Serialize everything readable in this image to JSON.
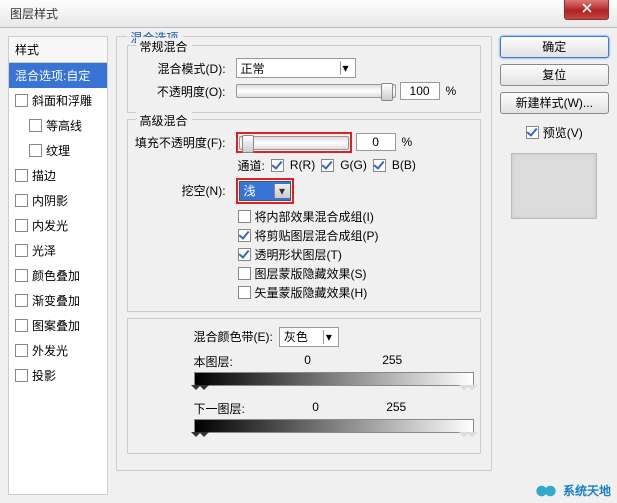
{
  "window": {
    "title": "图层样式"
  },
  "styles": {
    "header": "样式",
    "items": [
      {
        "label": "混合选项:自定",
        "selected": true,
        "noCheckbox": true
      },
      {
        "label": "斜面和浮雕"
      },
      {
        "label": "等高线",
        "indent": true
      },
      {
        "label": "纹理",
        "indent": true
      },
      {
        "label": "描边"
      },
      {
        "label": "内阴影"
      },
      {
        "label": "内发光"
      },
      {
        "label": "光泽"
      },
      {
        "label": "颜色叠加"
      },
      {
        "label": "渐变叠加"
      },
      {
        "label": "图案叠加"
      },
      {
        "label": "外发光"
      },
      {
        "label": "投影"
      }
    ]
  },
  "blend": {
    "fieldset": "混合选项",
    "general": {
      "title": "常规混合",
      "modeLabel": "混合模式(D):",
      "modeValue": "正常",
      "opacityLabel": "不透明度(O):",
      "opacityValue": "100",
      "pct": "%"
    },
    "advanced": {
      "title": "高级混合",
      "fillLabel": "填充不透明度(F):",
      "fillValue": "0",
      "pct": "%",
      "channelsLabel": "通道:",
      "channels": {
        "r": "R(R)",
        "g": "G(G)",
        "b": "B(B)"
      },
      "knockoutLabel": "挖空(N):",
      "knockoutValue": "浅",
      "opts": [
        {
          "label": "将内部效果混合成组(I)",
          "checked": false
        },
        {
          "label": "将剪贴图层混合成组(P)",
          "checked": true
        },
        {
          "label": "透明形状图层(T)",
          "checked": true
        },
        {
          "label": "图层蒙版隐藏效果(S)",
          "checked": false
        },
        {
          "label": "矢量蒙版隐藏效果(H)",
          "checked": false
        }
      ]
    },
    "blendif": {
      "label": "混合颜色带(E):",
      "value": "灰色",
      "thisLayer": "本图层:",
      "thisMin": "0",
      "thisMax": "255",
      "underLayer": "下一图层:",
      "underMin": "0",
      "underMax": "255"
    }
  },
  "buttons": {
    "ok": "确定",
    "cancel": "复位",
    "newStyle": "新建样式(W)...",
    "preview": "预览(V)"
  },
  "watermark": "系统天地"
}
